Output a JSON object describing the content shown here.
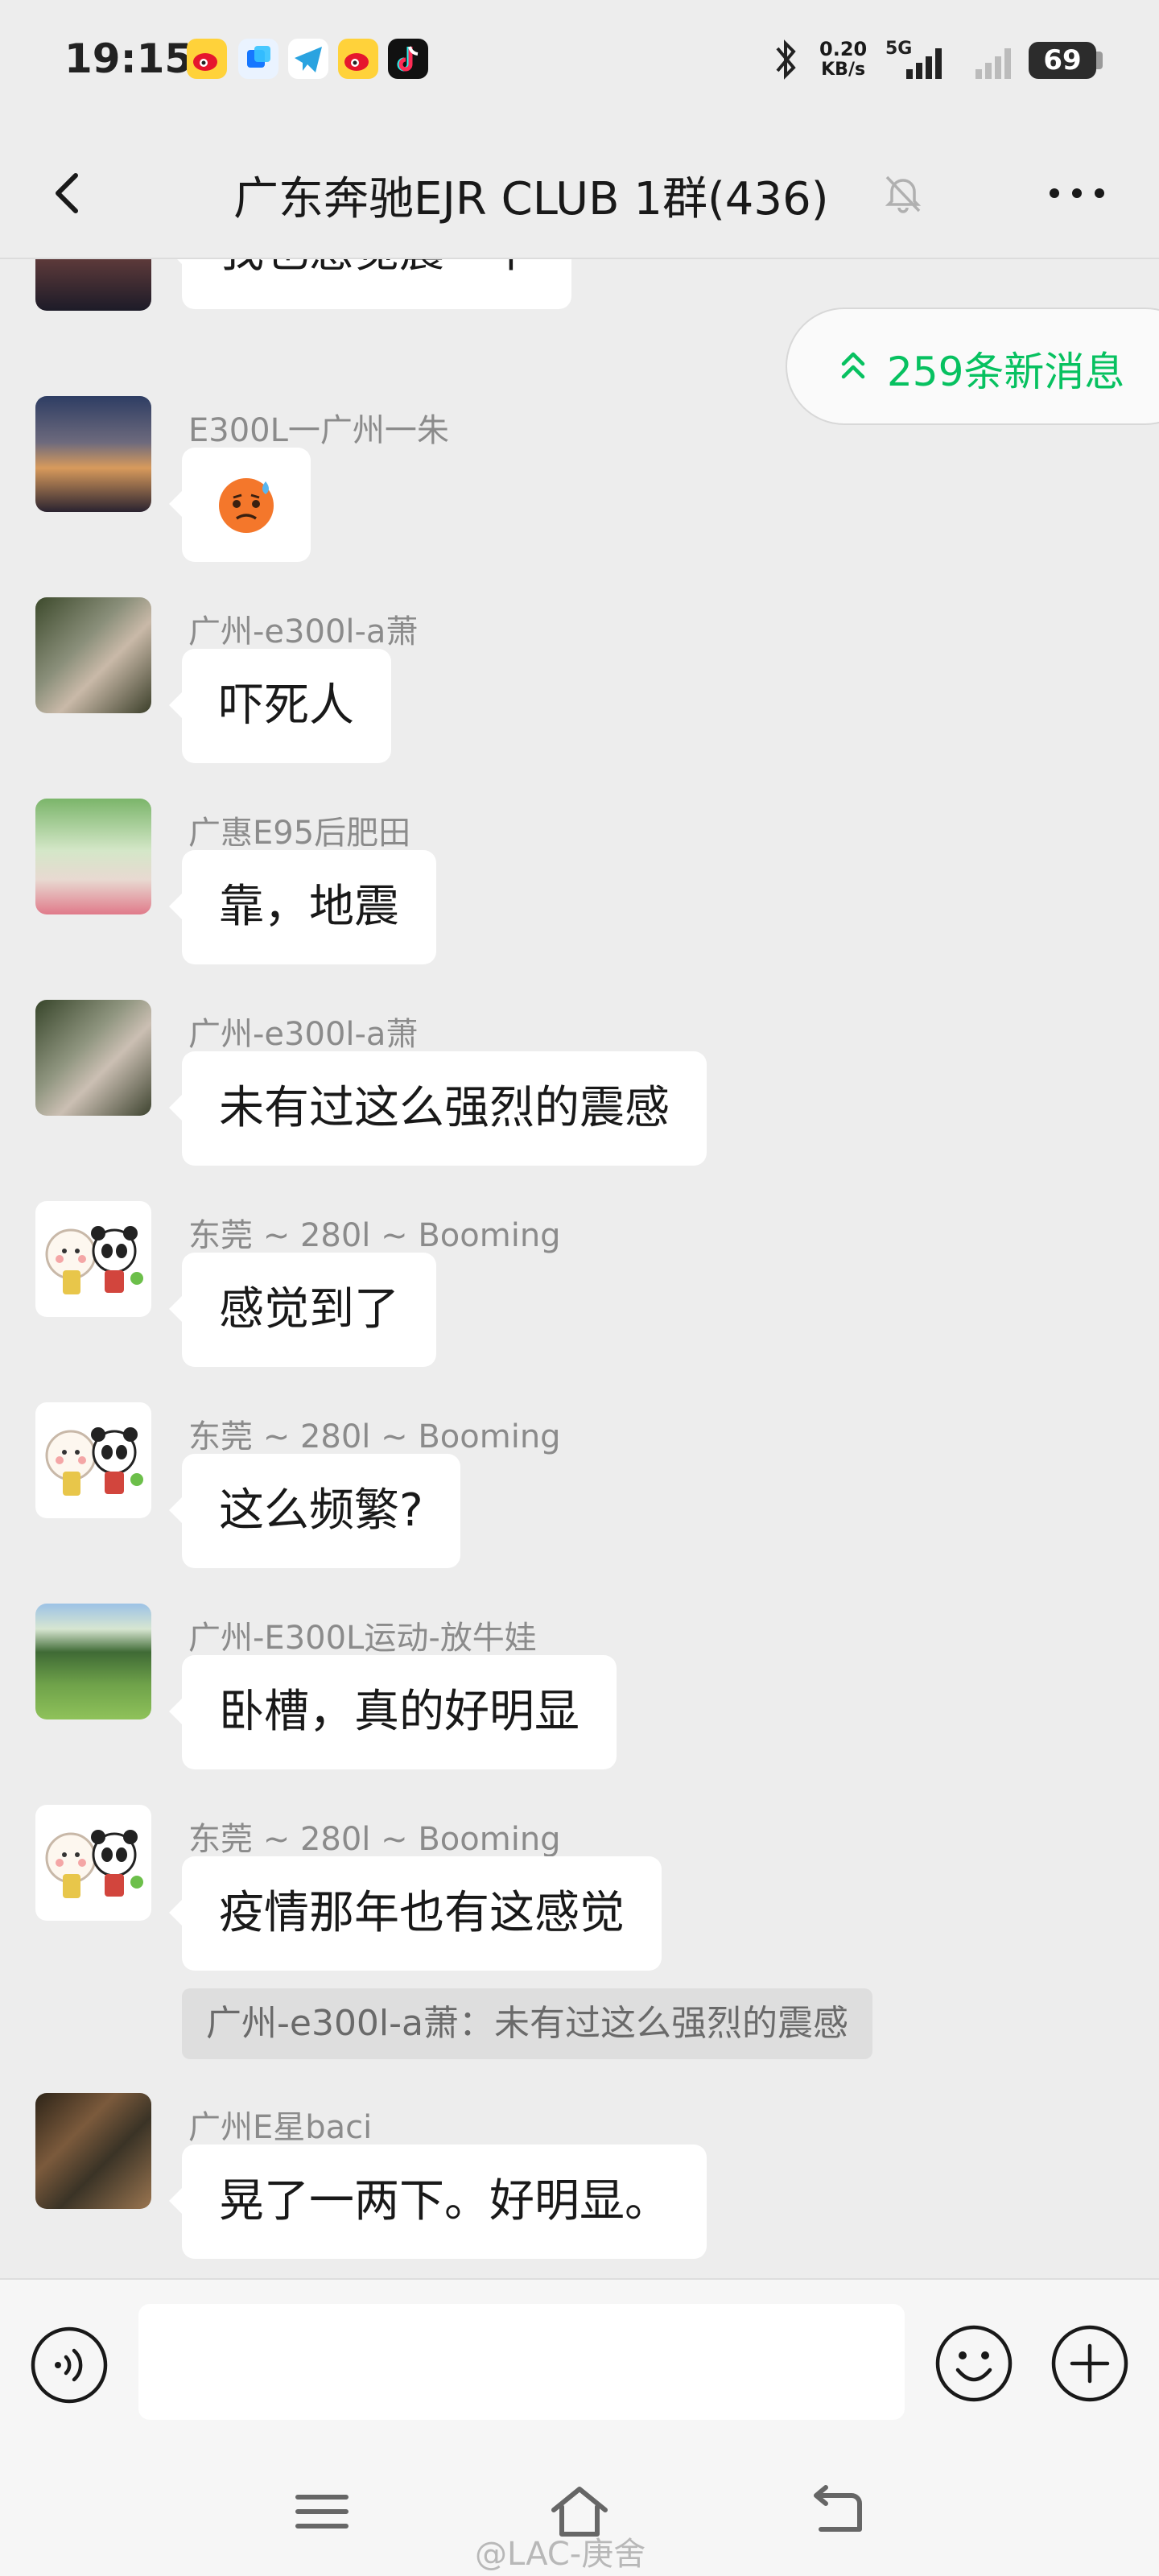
{
  "status_bar": {
    "time": "19:15",
    "net_speed_value": "0.20",
    "net_speed_unit": "KB/s",
    "network": "5G",
    "battery": "69"
  },
  "header": {
    "title": "广东奔驰EJR CLUB 1群(436)"
  },
  "new_messages": {
    "label": "259条新消息"
  },
  "messages": [
    {
      "sender": "",
      "text": "我也感觉震一下"
    },
    {
      "sender": "E300L一广州一朱",
      "text": "",
      "emoji": "sweat-face"
    },
    {
      "sender": "广州-e300l-a萧",
      "text": "吓死人"
    },
    {
      "sender": "广惠E95后肥田",
      "text": "靠，地震"
    },
    {
      "sender": "广州-e300l-a萧",
      "text": "未有过这么强烈的震感"
    },
    {
      "sender": "东莞 ~ 280l ~ Booming",
      "text": "感觉到了"
    },
    {
      "sender": "东莞 ~ 280l ~ Booming",
      "text": "这么频繁?"
    },
    {
      "sender": "广州-E300L运动-放牛娃",
      "text": "卧槽，真的好明显"
    },
    {
      "sender": "东莞 ~ 280l ~ Booming",
      "text": "疫情那年也有这感觉",
      "quote": "广州-e300l-a萧：未有过这么强烈的震感"
    },
    {
      "sender": "广州E星baci",
      "text": "晃了一两下。好明显。"
    }
  ],
  "input": {
    "placeholder": ""
  },
  "watermark": "@LAC-庚舍",
  "colors": {
    "accent": "#07c160",
    "background": "#ededed",
    "bubble": "#ffffff"
  }
}
